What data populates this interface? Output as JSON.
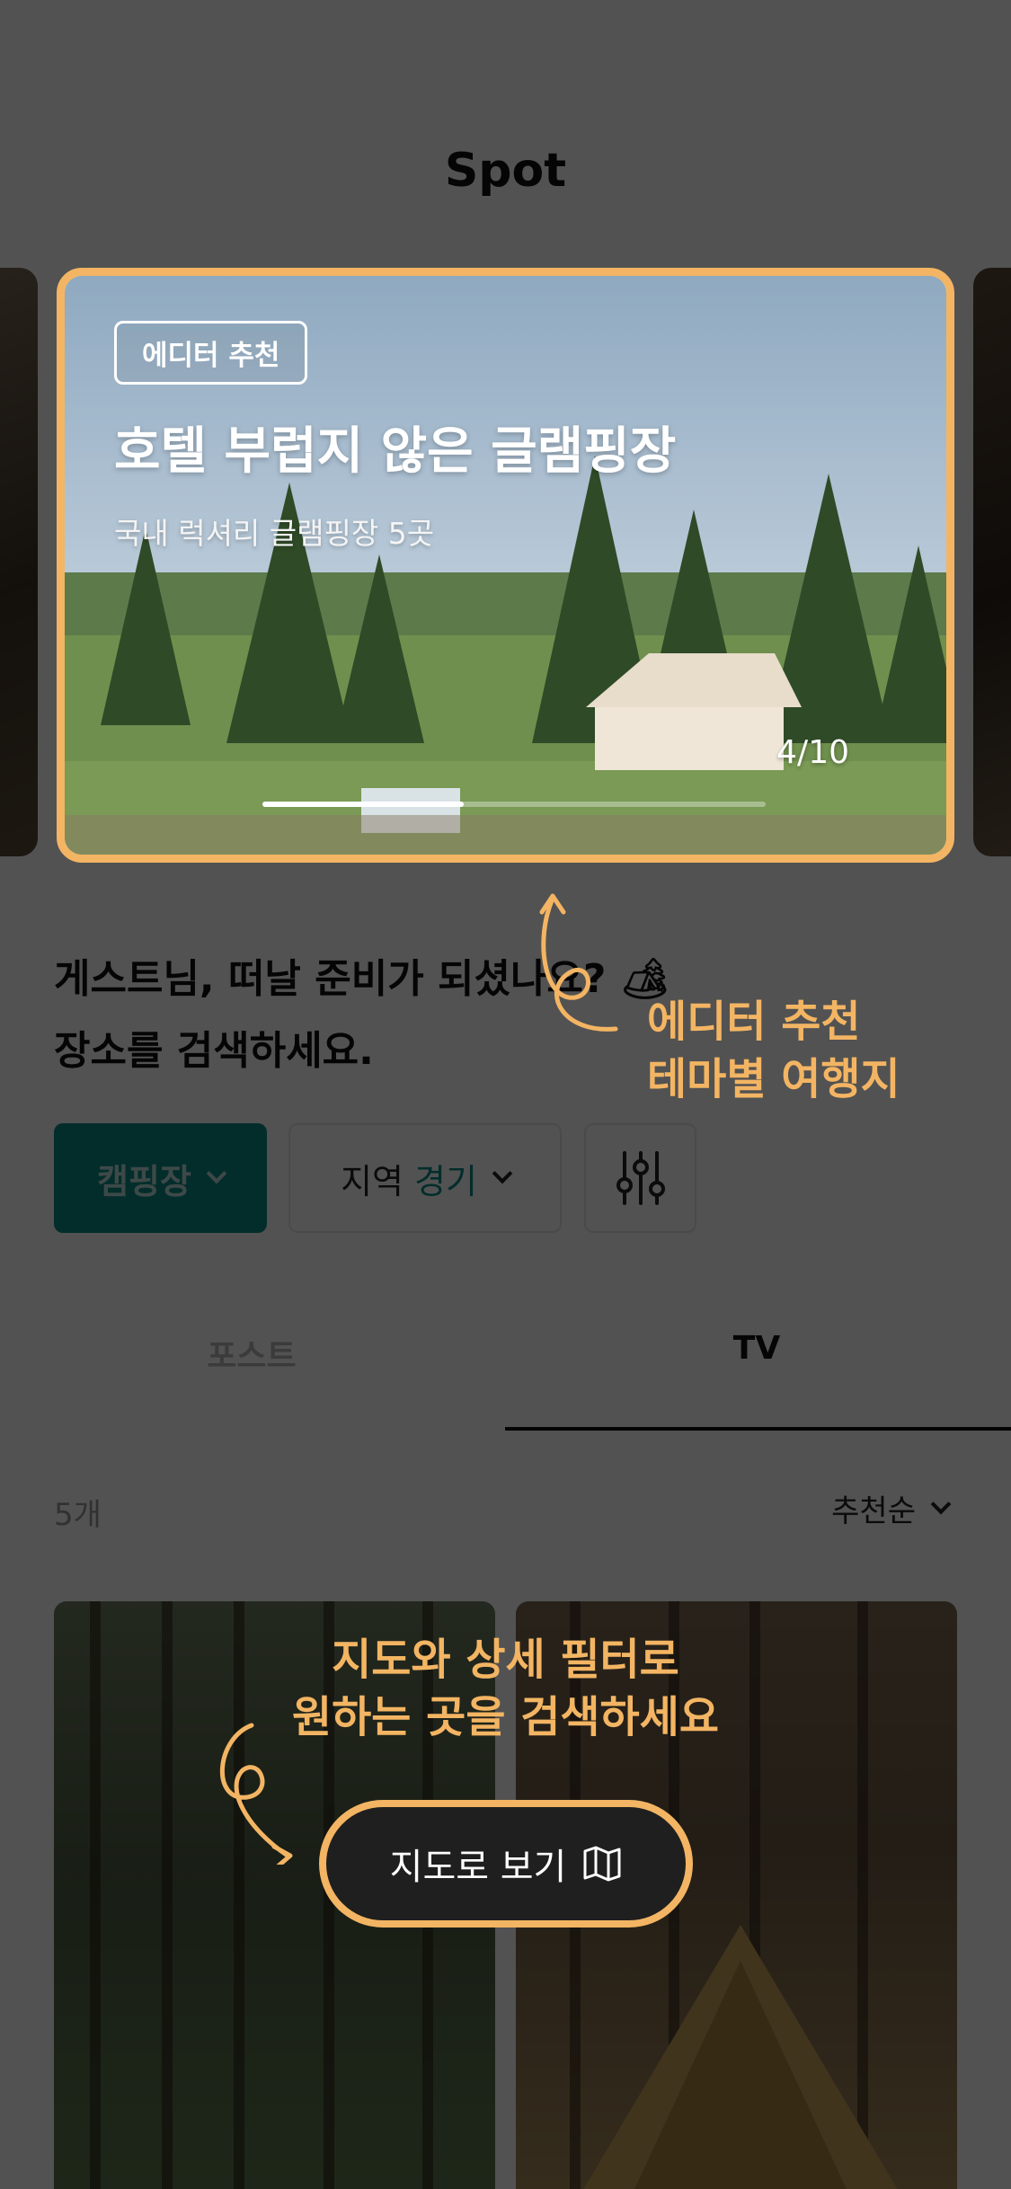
{
  "header": {
    "title": "Spot"
  },
  "hero": {
    "badge": "에디터 추천",
    "title": "호텔 부럽지 않은 글램핑장",
    "subtitle": "국내 럭셔리 글램핑장 5곳",
    "pager": "4/10",
    "progress_fraction": 0.4
  },
  "intro": {
    "line1": "게스트님, 떠날 준비가 되셨나요? 🏕",
    "line2": "장소를 검색하세요."
  },
  "filters": {
    "category_label": "캠핑장",
    "region_label": "지역",
    "region_value": "경기",
    "settings_icon": "sliders-icon"
  },
  "tabs": [
    {
      "label": "포스트",
      "active": false
    },
    {
      "label": "TV",
      "active": true
    }
  ],
  "list": {
    "count": "5개",
    "sort_label": "추천순"
  },
  "coach": {
    "callout1_line1": "에디터 추천",
    "callout1_line2": "테마별 여행지",
    "callout2_line1": "지도와 상세 필터로",
    "callout2_line2": "원하는 곳을 검색하세요",
    "map_button_label": "지도로 보기",
    "map_icon": "map-icon"
  },
  "colors": {
    "accent": "#f3b563",
    "teal": "#0b8c87"
  }
}
